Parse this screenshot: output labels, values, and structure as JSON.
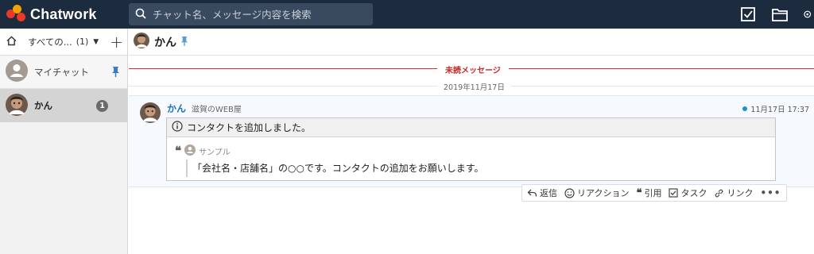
{
  "app": {
    "name": "Chatwork",
    "brand_colors": [
      "#e8392b",
      "#f3a300",
      "#e8392b"
    ],
    "topbar_color": "#1c2b3e"
  },
  "search": {
    "placeholder": "チャット名、メッセージ内容を検索"
  },
  "topbar_icons": [
    "task-checkbox-icon",
    "folder-icon",
    "settings-icon"
  ],
  "sidebar": {
    "filter_label": "すべての...",
    "filter_count": "(1)",
    "rooms": [
      {
        "name": "マイチャット",
        "pinned": true,
        "active": false
      },
      {
        "name": "かん",
        "unread": "1",
        "active": true
      }
    ]
  },
  "room": {
    "title": "かん",
    "pinned": true
  },
  "timeline": {
    "unread_label": "未読メッセージ",
    "date_label": "2019年11月17日",
    "message": {
      "sender": "かん",
      "org": "滋賀のWEB屋",
      "time": "11月17日 17:37",
      "info_text": "コンタクトを追加しました。",
      "quote_author": "サンプル",
      "quote_text": "「会社名・店舗名」の○○です。コンタクトの追加をお願いします。"
    },
    "actions": {
      "reply": "返信",
      "reaction": "リアクション",
      "quote": "引用",
      "task": "タスク",
      "link": "リンク",
      "more": "•••"
    }
  }
}
